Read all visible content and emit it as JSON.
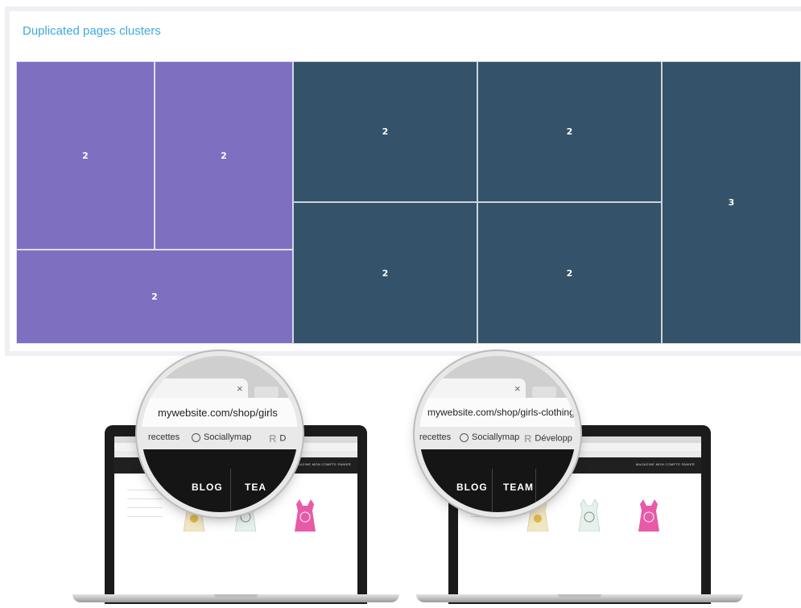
{
  "panel": {
    "title": "Duplicated pages clusters"
  },
  "treemap": {
    "colors": {
      "group_a": "#7f6fc1",
      "group_b": "#345269"
    },
    "tiles": [
      {
        "group": "a",
        "value": "2"
      },
      {
        "group": "a",
        "value": "2"
      },
      {
        "group": "a",
        "value": "2"
      },
      {
        "group": "b",
        "value": "2"
      },
      {
        "group": "b",
        "value": "2"
      },
      {
        "group": "b",
        "value": "2"
      },
      {
        "group": "b",
        "value": "2"
      },
      {
        "group": "b",
        "value": "3"
      }
    ]
  },
  "illustration": {
    "left": {
      "url": "mywebsite.com/shop/girls",
      "bookmarks": [
        "recettes",
        "Sociallymap",
        "D"
      ],
      "nav": [
        "BLOG",
        "TEA"
      ]
    },
    "right": {
      "url": "mywebsite.com/shop/girls-clothing",
      "bookmarks": [
        "recettes",
        "Sociallymap",
        "Développ"
      ],
      "nav": [
        "BLOG",
        "TEAM"
      ]
    },
    "close_glyph": "×",
    "site_menu": "MAGAZINE   MON COMPTE   PANIER"
  }
}
